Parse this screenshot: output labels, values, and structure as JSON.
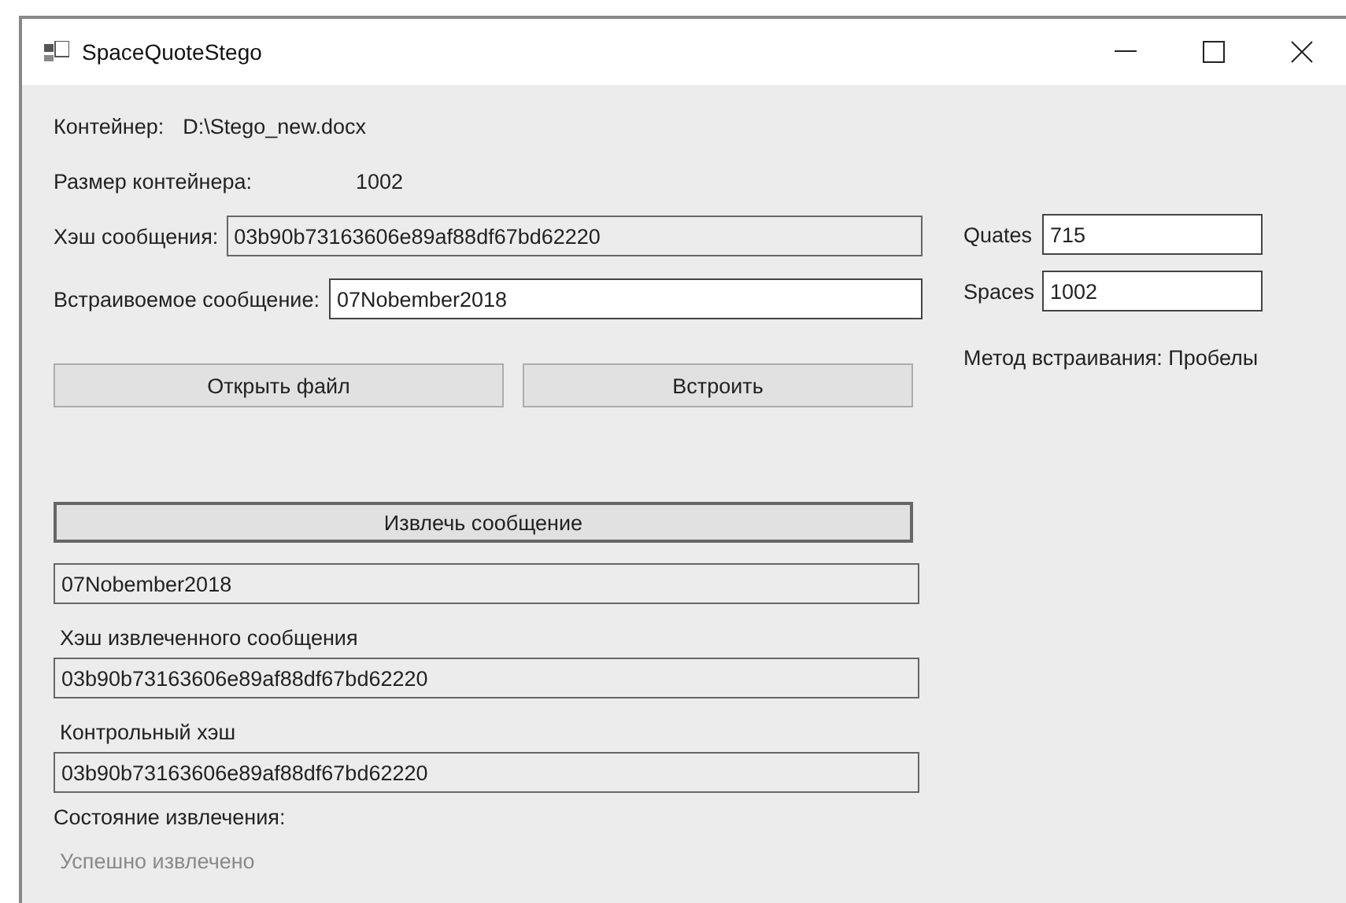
{
  "window": {
    "title": "SpaceQuoteStego"
  },
  "container": {
    "label": "Контейнер:",
    "value": "D:\\Stego_new.docx"
  },
  "container_size": {
    "label": "Размер контейнера:",
    "value": "1002"
  },
  "message_hash": {
    "label": "Хэш сообщения:",
    "value": "03b90b73163606e89af88df67bd62220",
    "readonly": true
  },
  "embedded_message": {
    "label": "Встраивоемое сообщение:",
    "value": "07Nobember2018",
    "readonly": false
  },
  "buttons": [
    {
      "label": "Открыть файл",
      "focused": false
    },
    {
      "label": "Встроить",
      "focused": false
    }
  ],
  "counts": [
    {
      "label": "Quates",
      "value": "715",
      "readonly": false
    },
    {
      "label": "Spaces",
      "value": "1002",
      "readonly": false
    }
  ],
  "method": "Метод встраивания: Пробелы",
  "extract_button": {
    "label": "Извлечь сообщение",
    "focused": true
  },
  "extracted_message": {
    "value": "07Nobember2018",
    "readonly": true
  },
  "extracted_hash": {
    "label": "Хэш извлеченного сообщения",
    "value": "03b90b73163606e89af88df67bd62220",
    "readonly": true
  },
  "control_hash": {
    "label": "Контрольный хэш",
    "value": "03b90b73163606e89af88df67bd62220",
    "readonly": true
  },
  "extraction_state": {
    "label": "Состояние извлечения:",
    "value": "Успешно извлечено",
    "disabled": true
  }
}
